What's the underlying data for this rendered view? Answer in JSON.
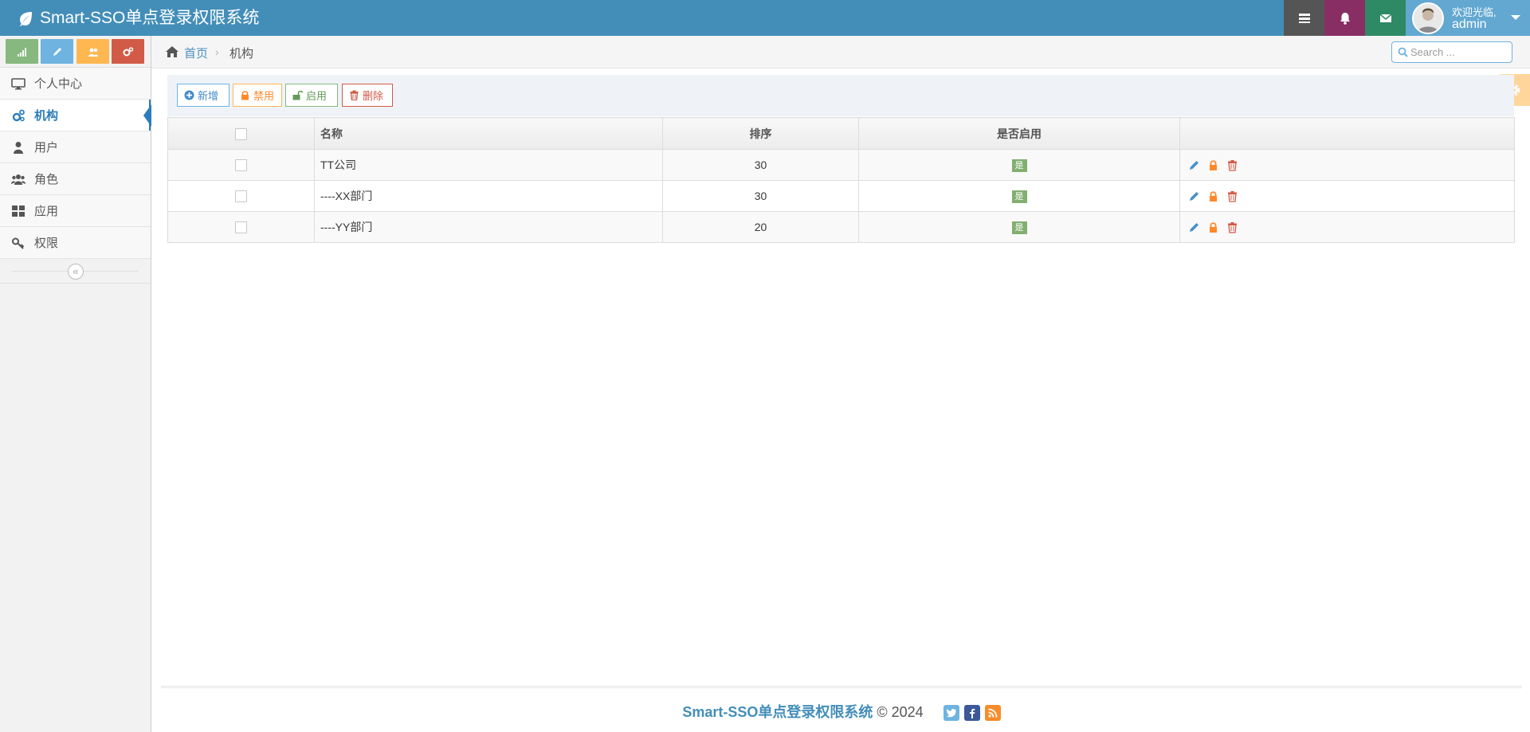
{
  "app": {
    "title": "Smart-SSO单点登录权限系统"
  },
  "navbar": {
    "user_welcome": "欢迎光临,",
    "user_name": "admin"
  },
  "sidebar": {
    "items": [
      {
        "label": "个人中心",
        "icon": "desktop-icon"
      },
      {
        "label": "机构",
        "icon": "cogs-icon",
        "active": true
      },
      {
        "label": "用户",
        "icon": "user-icon"
      },
      {
        "label": "角色",
        "icon": "users-icon"
      },
      {
        "label": "应用",
        "icon": "grid-icon"
      },
      {
        "label": "权限",
        "icon": "key-icon"
      }
    ],
    "collapse_glyph": "«"
  },
  "breadcrumb": {
    "home": "首页",
    "separator": "›",
    "current": "机构"
  },
  "search": {
    "placeholder": "Search ..."
  },
  "toolbar": {
    "add": "新增",
    "disable": "禁用",
    "enable": "启用",
    "delete": "删除"
  },
  "table": {
    "columns": [
      "名称",
      "排序",
      "是否启用"
    ],
    "rows": [
      {
        "name": "TT公司",
        "sort": "30",
        "enabled": "是"
      },
      {
        "name": "----XX部门",
        "sort": "30",
        "enabled": "是"
      },
      {
        "name": "----YY部门",
        "sort": "20",
        "enabled": "是"
      }
    ]
  },
  "footer": {
    "brand": "Smart-SSO单点登录权限系统",
    "copyright": "© 2024"
  },
  "colors": {
    "navbar": "#438eb9",
    "accent": "#2b7dbc",
    "success_badge": "#82af6f"
  }
}
